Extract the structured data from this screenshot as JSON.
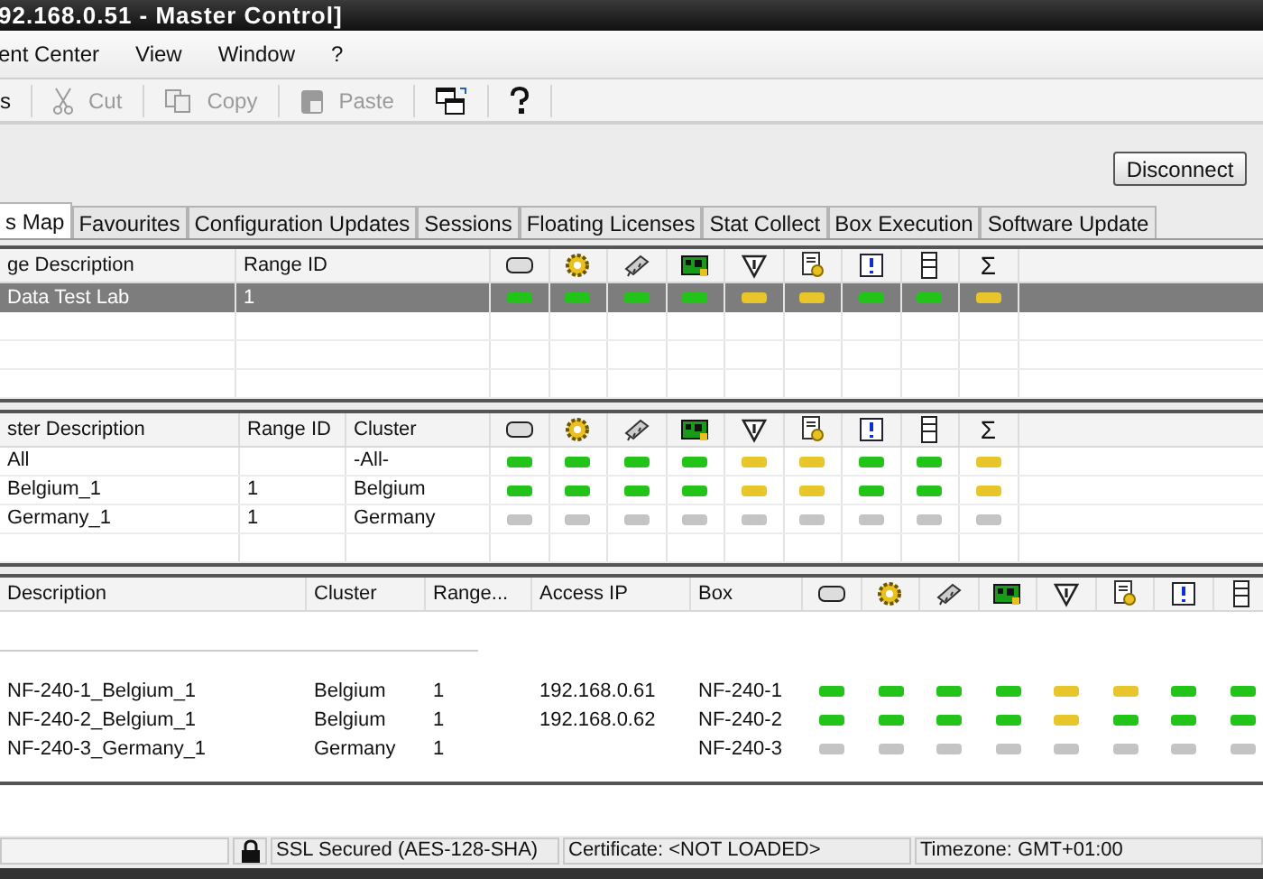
{
  "window": {
    "title": "92.168.0.51 - Master Control]"
  },
  "menu": [
    "ent Center",
    "View",
    "Window",
    "?"
  ],
  "toolbar": [
    {
      "kind": "text",
      "label": "s"
    },
    {
      "kind": "cut",
      "label": "Cut",
      "disabled": true
    },
    {
      "kind": "copy",
      "label": "Copy",
      "disabled": true
    },
    {
      "kind": "paste",
      "label": "Paste",
      "disabled": true
    },
    {
      "kind": "windows"
    },
    {
      "kind": "help"
    }
  ],
  "disconnect_button": "Disconnect",
  "tabs": [
    {
      "label": "s Map",
      "selected": true
    },
    {
      "label": "Favourites",
      "selected": false
    },
    {
      "label": "Configuration Updates",
      "selected": false
    },
    {
      "label": "Sessions",
      "selected": false
    },
    {
      "label": "Floating Licenses",
      "selected": false
    },
    {
      "label": "Stat Collect",
      "selected": false
    },
    {
      "label": "Box Execution",
      "selected": false
    },
    {
      "label": "Software Update",
      "selected": false
    }
  ],
  "tables": [
    {
      "columns": [
        "ge Description",
        "Range ID"
      ],
      "sum_label": "Σ",
      "rows": [
        {
          "cells": [
            "Data Test Lab",
            "1"
          ],
          "selected": true,
          "lights": [
            {
              "color": "#22c41a"
            },
            {
              "color": "#22c41a"
            },
            {
              "color": "#22c41a"
            },
            {
              "color": "#22c41a"
            },
            {
              "color": "#e8c52a"
            },
            {
              "color": "#e8c52a"
            },
            {
              "color": "#22c41a"
            },
            {
              "color": "#22c41a"
            },
            {
              "color": "#e8c52a"
            }
          ]
        }
      ]
    },
    {
      "columns": [
        "ster Description",
        "Range ID",
        "Cluster"
      ],
      "sum_label": "Σ",
      "rows": [
        {
          "cells": [
            "All",
            "",
            "-All-"
          ],
          "selected": false,
          "lights": [
            {
              "color": "#22c41a"
            },
            {
              "color": "#22c41a"
            },
            {
              "color": "#22c41a"
            },
            {
              "color": "#22c41a"
            },
            {
              "color": "#e8c52a"
            },
            {
              "color": "#e8c52a"
            },
            {
              "color": "#22c41a"
            },
            {
              "color": "#22c41a"
            },
            {
              "color": "#e8c52a"
            }
          ]
        },
        {
          "cells": [
            "Belgium_1",
            "1",
            "Belgium"
          ],
          "selected": false,
          "lights": [
            {
              "color": "#22c41a"
            },
            {
              "color": "#22c41a"
            },
            {
              "color": "#22c41a"
            },
            {
              "color": "#22c41a"
            },
            {
              "color": "#e8c52a"
            },
            {
              "color": "#e8c52a"
            },
            {
              "color": "#22c41a"
            },
            {
              "color": "#22c41a"
            },
            {
              "color": "#e8c52a"
            }
          ]
        },
        {
          "cells": [
            "Germany_1",
            "1",
            "Germany"
          ],
          "selected": false,
          "lights": [
            {
              "color": "#c4c4c4"
            },
            {
              "color": "#c4c4c4"
            },
            {
              "color": "#c4c4c4"
            },
            {
              "color": "#c4c4c4"
            },
            {
              "color": "#c4c4c4"
            },
            {
              "color": "#c4c4c4"
            },
            {
              "color": "#c4c4c4"
            },
            {
              "color": "#c4c4c4"
            },
            {
              "color": "#c4c4c4"
            }
          ]
        }
      ]
    },
    {
      "columns": [
        "Description",
        "Cluster",
        "Range...",
        "Access IP",
        "Box"
      ],
      "rows": [
        {
          "cells": [
            "NF-240-1_Belgium_1",
            "Belgium",
            "1",
            "192.168.0.61",
            "NF-240-1"
          ],
          "selected": false,
          "lights": [
            {
              "color": "#22c41a"
            },
            {
              "color": "#22c41a"
            },
            {
              "color": "#22c41a"
            },
            {
              "color": "#22c41a"
            },
            {
              "color": "#e8c52a"
            },
            {
              "color": "#e8c52a"
            },
            {
              "color": "#22c41a"
            },
            {
              "color": "#22c41a"
            }
          ]
        },
        {
          "cells": [
            "NF-240-2_Belgium_1",
            "Belgium",
            "1",
            "192.168.0.62",
            "NF-240-2"
          ],
          "selected": false,
          "lights": [
            {
              "color": "#22c41a"
            },
            {
              "color": "#22c41a"
            },
            {
              "color": "#22c41a"
            },
            {
              "color": "#22c41a"
            },
            {
              "color": "#e8c52a"
            },
            {
              "color": "#22c41a"
            },
            {
              "color": "#22c41a"
            },
            {
              "color": "#22c41a"
            }
          ]
        },
        {
          "cells": [
            "NF-240-3_Germany_1",
            "Germany",
            "1",
            "",
            "NF-240-3"
          ],
          "selected": false,
          "lights": [
            {
              "color": "#c4c4c4"
            },
            {
              "color": "#c4c4c4"
            },
            {
              "color": "#c4c4c4"
            },
            {
              "color": "#c4c4c4"
            },
            {
              "color": "#c4c4c4"
            },
            {
              "color": "#c4c4c4"
            },
            {
              "color": "#c4c4c4"
            },
            {
              "color": "#c4c4c4"
            }
          ]
        }
      ]
    }
  ],
  "status_bar": {
    "ssl": "SSL Secured (AES-128-SHA)",
    "certificate": "Certificate: <NOT LOADED>",
    "timezone": "Timezone: GMT+01:00"
  }
}
